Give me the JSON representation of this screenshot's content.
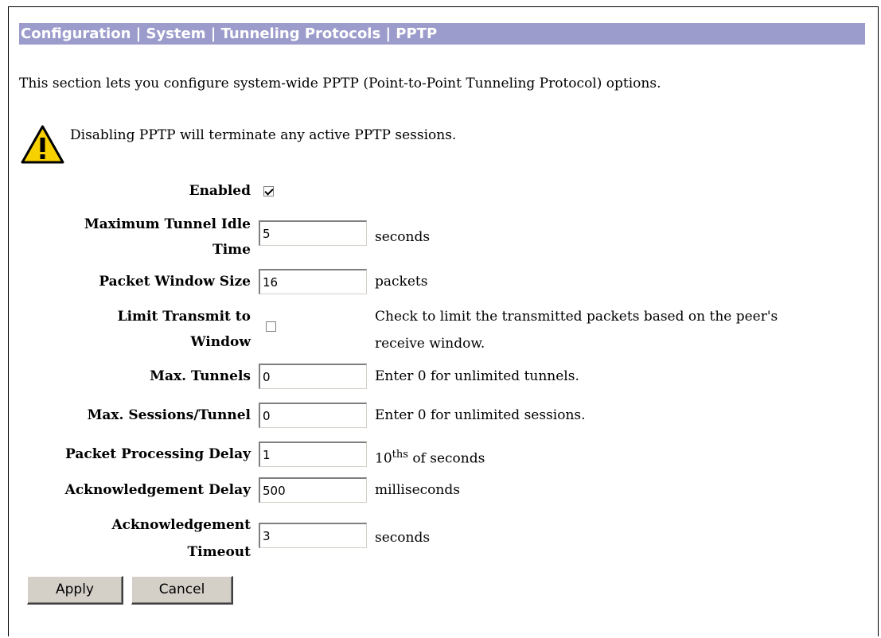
{
  "breadcrumb": "Configuration | System | Tunneling Protocols | PPTP",
  "intro": "This section lets you configure system-wide PPTP (Point-to-Point Tunneling Protocol) options.",
  "warning": "Disabling PPTP will terminate any active PPTP sessions.",
  "fields": {
    "enabled": {
      "label": "Enabled",
      "checked": true
    },
    "max_idle": {
      "label_line1": "Maximum Tunnel Idle",
      "label_line2": "Time",
      "value": "5",
      "unit": "seconds"
    },
    "window_size": {
      "label": "Packet Window Size",
      "value": "16",
      "unit": "packets"
    },
    "limit_transmit": {
      "label_line1": "Limit Transmit to",
      "label_line2": "Window",
      "checked": false,
      "help_line1": "Check to limit the transmitted packets based on the peer's",
      "help_line2": "receive window."
    },
    "max_tunnels": {
      "label": "Max. Tunnels",
      "value": "0",
      "unit": "Enter 0 for unlimited tunnels."
    },
    "max_sessions": {
      "label": "Max. Sessions/Tunnel",
      "value": "0",
      "unit": "Enter 0 for unlimited sessions."
    },
    "proc_delay": {
      "label": "Packet Processing Delay",
      "value": "1",
      "unit_base": "10",
      "unit_sup": "ths",
      "unit_rest": " of seconds"
    },
    "ack_delay": {
      "label": "Acknowledgement Delay",
      "value": "500",
      "unit": "milliseconds"
    },
    "ack_timeout": {
      "label_line1": "Acknowledgement",
      "label_line2": "Timeout",
      "value": "3",
      "unit": "seconds"
    }
  },
  "buttons": {
    "apply": "Apply",
    "cancel": "Cancel"
  },
  "colors": {
    "breadcrumb_bg": "#9c9ccc",
    "warning_yellow": "#f7d000"
  }
}
